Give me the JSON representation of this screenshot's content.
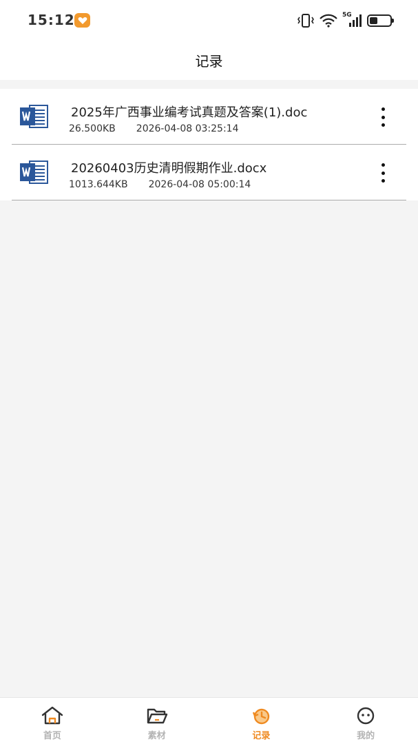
{
  "status_bar": {
    "time": "15:12",
    "network": "5G",
    "battery_level": 0.4,
    "icons": [
      "heart-app-icon",
      "vibrate-icon",
      "wifi-icon",
      "signal-icon",
      "battery-icon"
    ]
  },
  "header": {
    "title": "记录"
  },
  "records": [
    {
      "file_type": "word",
      "name": "2025年广西事业编考试真题及答案(1).doc",
      "size": "26.500KB",
      "date": "2026-04-08 03:25:14"
    },
    {
      "file_type": "word",
      "name": "20260403历史清明假期作业.docx",
      "size": "1013.644KB",
      "date": "2026-04-08 05:00:14"
    }
  ],
  "tabs": [
    {
      "label": "首页",
      "icon": "home-icon",
      "active": false
    },
    {
      "label": "素材",
      "icon": "folder-icon",
      "active": false
    },
    {
      "label": "记录",
      "icon": "history-icon",
      "active": true
    },
    {
      "label": "我的",
      "icon": "profile-face-icon",
      "active": false
    }
  ],
  "colors": {
    "accent": "#ef8a21",
    "tab_inactive": "#b3b3b3",
    "background": "#f4f4f4",
    "word_blue": "#2b579a"
  }
}
